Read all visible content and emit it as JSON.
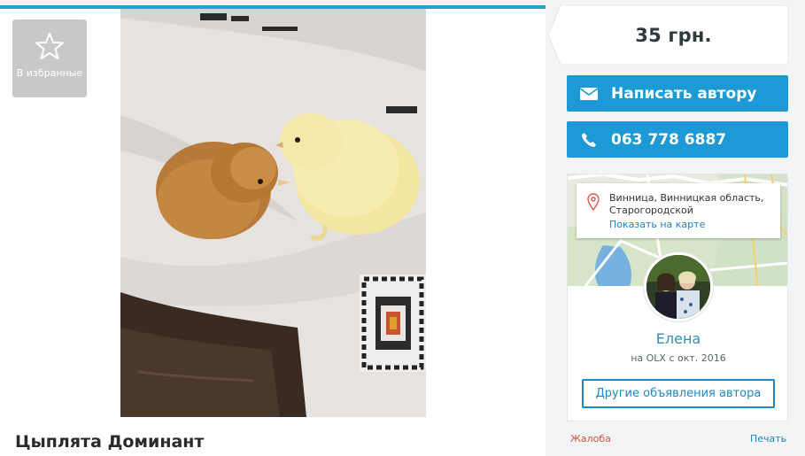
{
  "favorites": {
    "label": "В избранные",
    "icon": "star-icon"
  },
  "listing": {
    "title": "Цыплята Доминант",
    "photo": "chicks-photo",
    "price": "35 грн."
  },
  "actions": {
    "write_label": "Написать автору",
    "write_icon": "envelope-icon",
    "phone": "063 778 6887",
    "phone_icon": "phone-icon"
  },
  "location": {
    "address_line1": "Винница, Винницкая область,",
    "address_line2": "Старогородской",
    "show_map_label": "Показать на карте",
    "icon": "map-pin-icon"
  },
  "seller": {
    "name": "Елена",
    "since": "на OLX с окт. 2016",
    "other_ads_label": "Другие объявления автора"
  },
  "footer": {
    "complaint_label": "Жалоба",
    "print_label": "Печать"
  },
  "colors": {
    "accent": "#1d9ad6",
    "top_bar": "#23a3d4",
    "complaint": "#d2543d",
    "link": "#1d80c2"
  }
}
